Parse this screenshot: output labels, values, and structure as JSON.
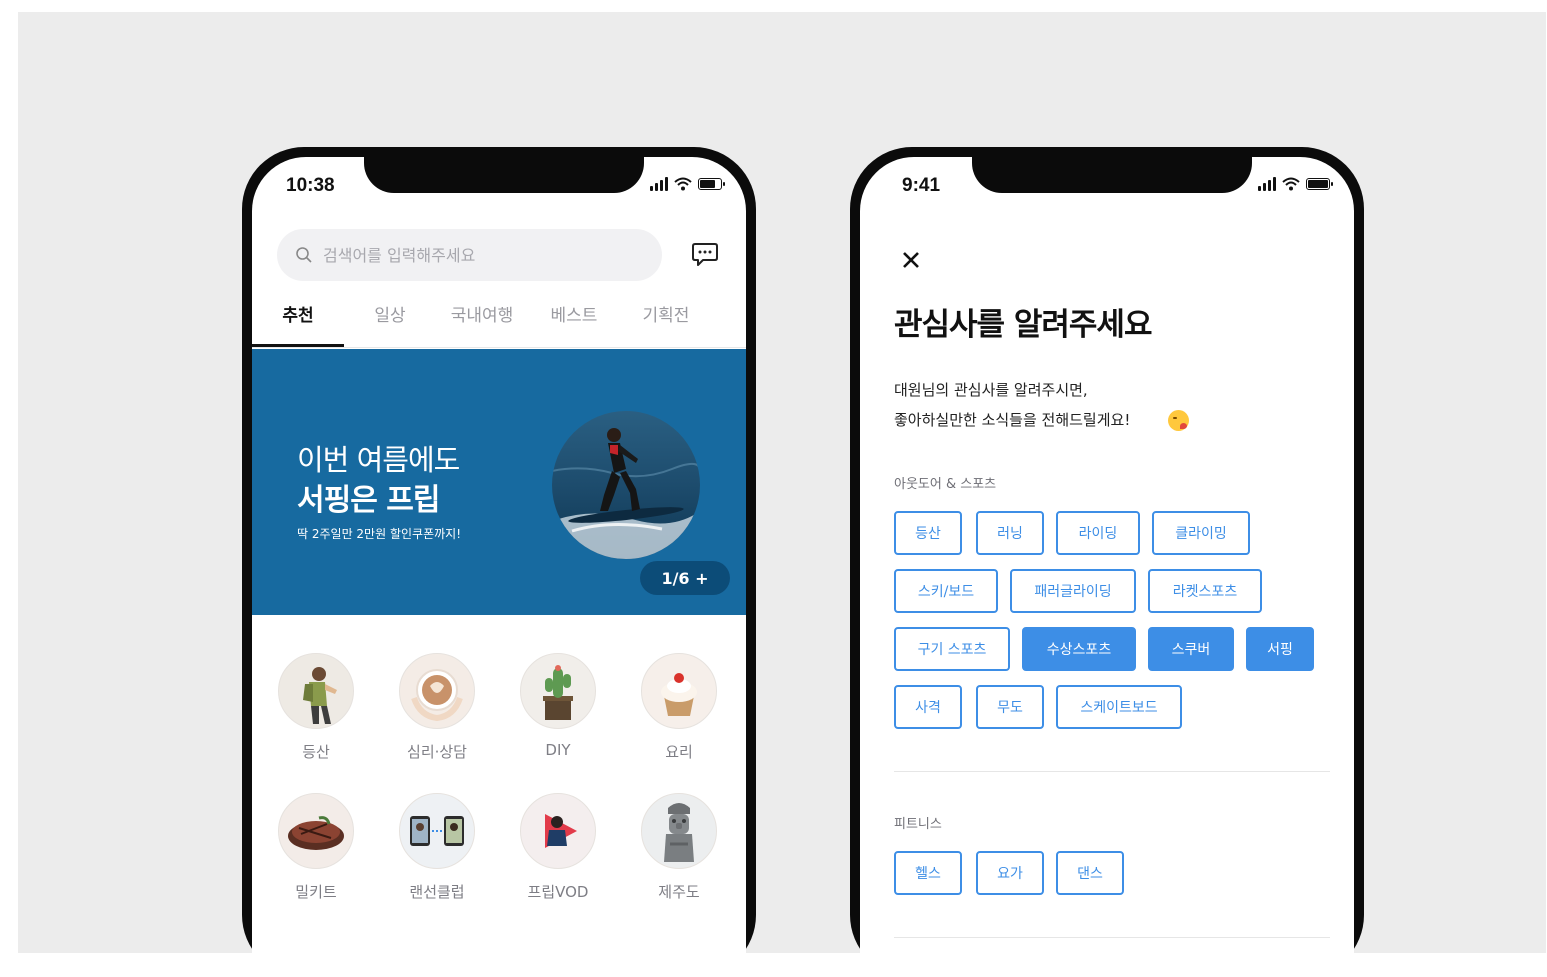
{
  "left_phone": {
    "status": {
      "time": "10:38"
    },
    "search": {
      "placeholder": "검색어를 입력해주세요"
    },
    "tabs": [
      "추천",
      "일상",
      "국내여행",
      "베스트",
      "기획전"
    ],
    "active_tab": "추천",
    "banner": {
      "line1": "이번 여름에도",
      "line2": "서핑은 프립",
      "line3": "딱 2주일만 2만원 할인쿠폰까지!",
      "page_indicator": "1/6 +",
      "background": "#176aa0"
    },
    "categories": [
      {
        "label": "등산",
        "icon": "hiker-icon"
      },
      {
        "label": "심리·상담",
        "icon": "latte-icon"
      },
      {
        "label": "DIY",
        "icon": "cactus-icon"
      },
      {
        "label": "요리",
        "icon": "cupcake-icon"
      },
      {
        "label": "밀키트",
        "icon": "steak-icon"
      },
      {
        "label": "랜선클럽",
        "icon": "video-call-icon"
      },
      {
        "label": "프립VOD",
        "icon": "play-icon"
      },
      {
        "label": "제주도",
        "icon": "dol-hareubang-icon"
      }
    ]
  },
  "right_phone": {
    "status": {
      "time": "9:41"
    },
    "title": "관심사를 알려주세요",
    "description": [
      "대원님의 관심사를 알려주시면,",
      "좋아하실만한 소식들을 전해드릴게요!"
    ],
    "sections": [
      {
        "label": "아웃도어 & 스포츠",
        "chips": [
          {
            "label": "등산",
            "selected": false
          },
          {
            "label": "러닝",
            "selected": false
          },
          {
            "label": "라이딩",
            "selected": false
          },
          {
            "label": "클라이밍",
            "selected": false
          },
          {
            "label": "스키/보드",
            "selected": false
          },
          {
            "label": "패러글라이딩",
            "selected": false
          },
          {
            "label": "라켓스포츠",
            "selected": false
          },
          {
            "label": "구기 스포츠",
            "selected": false
          },
          {
            "label": "수상스포츠",
            "selected": true
          },
          {
            "label": "스쿠버",
            "selected": true
          },
          {
            "label": "서핑",
            "selected": true
          },
          {
            "label": "사격",
            "selected": false
          },
          {
            "label": "무도",
            "selected": false
          },
          {
            "label": "스케이트보드",
            "selected": false
          }
        ]
      },
      {
        "label": "피트니스",
        "chips": [
          {
            "label": "헬스",
            "selected": false
          },
          {
            "label": "요가",
            "selected": false
          },
          {
            "label": "댄스",
            "selected": false
          }
        ]
      }
    ],
    "accent": "#3d8ee6"
  }
}
